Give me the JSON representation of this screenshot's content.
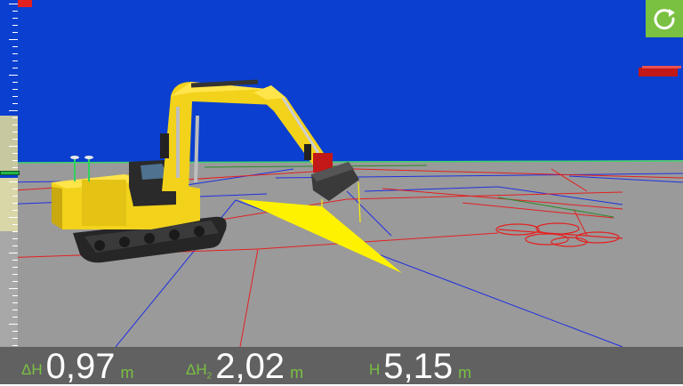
{
  "readouts": [
    {
      "label_main": "ΔH",
      "label_sub": "",
      "value": "0,97",
      "unit": "m"
    },
    {
      "label_main": "ΔH",
      "label_sub": "2",
      "value": "2,02",
      "unit": "m"
    },
    {
      "label_main": "H",
      "label_sub": "",
      "value": "5,15",
      "unit": "m"
    }
  ],
  "icons": {
    "reset": "refresh-icon"
  },
  "colors": {
    "sky": "#0a3fd0",
    "ground": "#9a9a9a",
    "machine": "#f2d21b",
    "accent_green": "#7ac142",
    "bar": "#616161",
    "design_line_red": "#e32020",
    "grid_blue": "#1f2fe0"
  }
}
